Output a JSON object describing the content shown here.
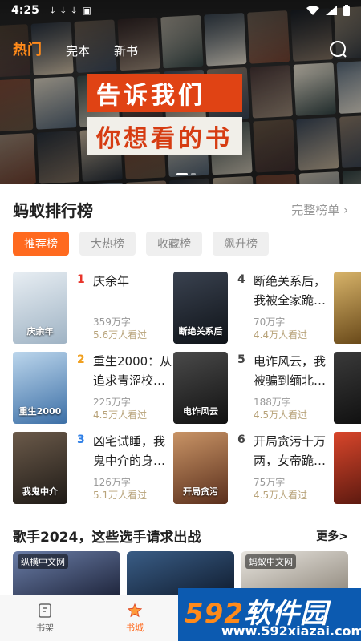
{
  "status_bar": {
    "time": "4:25"
  },
  "header": {
    "tabs": [
      {
        "label": "热门",
        "active": true
      },
      {
        "label": "完本",
        "active": false
      },
      {
        "label": "新书",
        "active": false
      }
    ]
  },
  "banner": {
    "line1": "告诉我们",
    "line2": "你想看的书"
  },
  "ranking": {
    "title": "蚂蚁排行榜",
    "more": "完整榜单 ›",
    "tabs": [
      "推荐榜",
      "大热榜",
      "收藏榜",
      "飙升榜"
    ],
    "books": [
      {
        "rank": "1",
        "title": "庆余年",
        "words": "359万字",
        "reads": "5.6万人看过",
        "cover_text": "庆余年"
      },
      {
        "rank": "2",
        "title": "重生2000：从追求青涩校…",
        "words": "225万字",
        "reads": "4.5万人看过",
        "cover_text": "重生2000"
      },
      {
        "rank": "3",
        "title": "凶宅试睡，我鬼中介的身…",
        "words": "126万字",
        "reads": "5.1万人看过",
        "cover_text": "我鬼中介"
      },
      {
        "rank": "4",
        "title": "断绝关系后，我被全家跪…",
        "words": "70万字",
        "reads": "4.4万人看过",
        "cover_text": "断绝关系后"
      },
      {
        "rank": "5",
        "title": "电诈风云，我被骗到缅北…",
        "words": "188万字",
        "reads": "4.5万人看过",
        "cover_text": "电诈风云"
      },
      {
        "rank": "6",
        "title": "开局贪污十万两，女帝跪…",
        "words": "75万字",
        "reads": "4.5万人看过",
        "cover_text": "开局贪污"
      }
    ],
    "rank_colors": {
      "1": "#e8352b",
      "2": "#f0a020",
      "3": "#2f7fe6",
      "default": "#444444"
    }
  },
  "singer": {
    "title": "歌手2024，这些选手请求出战",
    "more": "更多>",
    "cards": [
      {
        "badge": "纵横中文网"
      },
      {
        "badge": ""
      },
      {
        "badge": "蚂蚁中文网"
      }
    ]
  },
  "bottom_nav": [
    {
      "label": "书架",
      "icon": "bookshelf-icon",
      "active": false
    },
    {
      "label": "书城",
      "icon": "star-icon",
      "active": true
    }
  ],
  "watermark": {
    "logo_num": "592",
    "logo_text": "软件园",
    "url": "www.592xiazai.com"
  }
}
